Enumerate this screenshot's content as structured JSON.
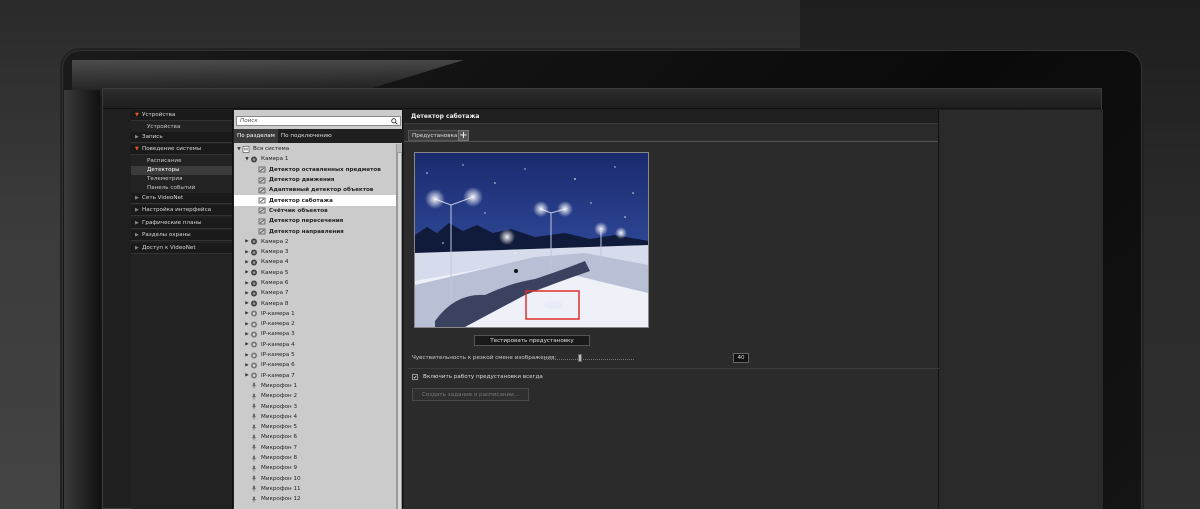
{
  "nav": {
    "groups": [
      {
        "label": "Устройства",
        "open": true,
        "items": [
          "Устройства"
        ]
      },
      {
        "label": "Запись",
        "open": false,
        "items": []
      },
      {
        "label": "Поведение системы",
        "open": true,
        "items": [
          "Расписание",
          "Детекторы",
          "Телеметрия",
          "Панель событий"
        ],
        "selected": "Детекторы"
      },
      {
        "label": "Сеть VideoNet",
        "open": false,
        "items": []
      },
      {
        "label": "Настройка интерфейса",
        "open": false,
        "items": []
      },
      {
        "label": "Графические планы",
        "open": false,
        "items": []
      },
      {
        "label": "Разделы охраны",
        "open": false,
        "items": []
      },
      {
        "label": "Доступ к VideoNet",
        "open": false,
        "items": []
      }
    ]
  },
  "tree_panel": {
    "search_placeholder": "Поиск",
    "tabs": [
      "По разделам",
      "По подключению"
    ],
    "active_tab": 0,
    "root": "Вся система",
    "camera1": "Камера 1",
    "detectors": [
      "Детектор оставленных предметов",
      "Детектор движения",
      "Адаптивный детектор объектов",
      "Детектор саботажа",
      "Счётчик объектов",
      "Детектор пересечения",
      "Детектор направления"
    ],
    "selected_detector": "Детектор саботажа",
    "cameras": [
      "Камера 2",
      "Камера 3",
      "Камера 4",
      "Камера 5",
      "Камера 6",
      "Камера 7",
      "Камера 8"
    ],
    "ip_cameras": [
      "IP-камера 1",
      "IP-камера 2",
      "IP-камера 3",
      "IP-камера 4",
      "IP-камера 5",
      "IP-камера 6",
      "IP-камера 7"
    ],
    "microphones": [
      "Микрофон 1",
      "Микрофон 2",
      "Микрофон 3",
      "Микрофон 4",
      "Микрофон 5",
      "Микрофон 6",
      "Микрофон 7",
      "Микрофон 8",
      "Микрофон 9",
      "Микрофон 10",
      "Микрофон 11",
      "Микрофон 12"
    ]
  },
  "detail": {
    "title": "Детектор саботажа",
    "preset_tab": "Предустановка 1",
    "preset_add": "+",
    "test_button": "Тестировать предустановку",
    "sensitivity_label": "Чувствительность к резкой смене изображения:",
    "sensitivity_value": "40",
    "sensitivity_fraction": 0.4,
    "checkbox_label": "Включить работу предустановки всегда",
    "checkbox_checked": true,
    "schedule_button": "Создать задание в расписании..."
  },
  "colors": {
    "accent_arrow": "#e25a1c",
    "selection_box": "#e0302a"
  }
}
